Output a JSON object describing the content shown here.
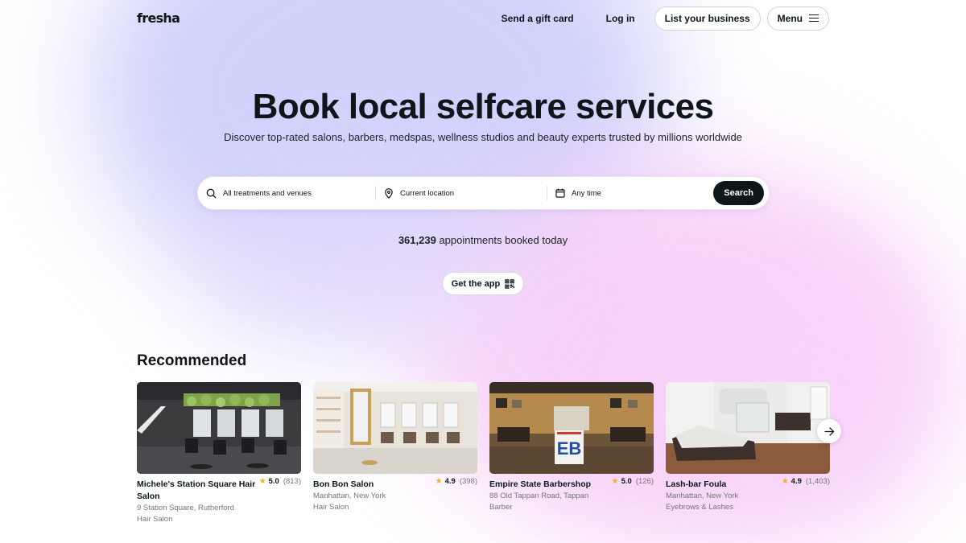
{
  "header": {
    "logo": "fresha",
    "gift_card": "Send a gift card",
    "login": "Log in",
    "list_business": "List your business",
    "menu": "Menu"
  },
  "hero": {
    "title": "Book local selfcare services",
    "subtitle": "Discover top-rated salons, barbers, medspas, wellness studios and beauty experts trusted by millions worldwide"
  },
  "search": {
    "treatments_placeholder": "All treatments and venues",
    "location_placeholder": "Current location",
    "time_placeholder": "Any time",
    "button": "Search"
  },
  "stats": {
    "count": "361,239",
    "suffix": " appointments booked today"
  },
  "app_button": "Get the app",
  "recommended": {
    "title": "Recommended",
    "venues": [
      {
        "name": "Michele's Station Square Hair Salon",
        "rating": "5.0",
        "reviews": "(813)",
        "address": "9 Station Square, Rutherford",
        "category": "Hair Salon"
      },
      {
        "name": "Bon Bon Salon",
        "rating": "4.9",
        "reviews": "(398)",
        "address": "Manhattan, New York",
        "category": "Hair Salon"
      },
      {
        "name": "Empire State Barbershop",
        "rating": "5.0",
        "reviews": "(126)",
        "address": "88 Old Tappan Road, Tappan",
        "category": "Barber"
      },
      {
        "name": "Lash-bar Foula",
        "rating": "4.9",
        "reviews": "(1,403)",
        "address": "Manhattan, New York",
        "category": "Eyebrows & Lashes"
      }
    ]
  },
  "colors": {
    "text": "#0d1619",
    "muted": "#757676",
    "star": "#f2b01e",
    "accent_lavender": "#cfd0fb",
    "accent_pink": "#f7cdf7"
  }
}
